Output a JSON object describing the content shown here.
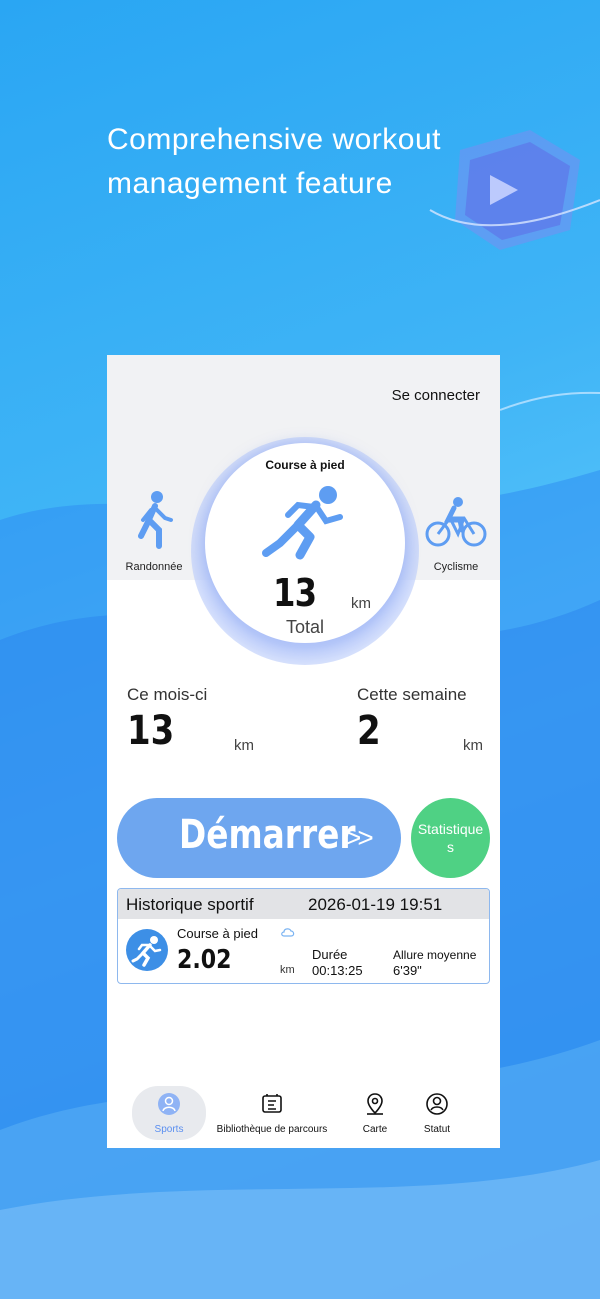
{
  "promo": {
    "headline_line1": "Comprehensive workout",
    "headline_line2": "management feature"
  },
  "app": {
    "login_label": "Se connecter",
    "sports": {
      "left": {
        "label": "Randonnée",
        "icon": "walking-icon"
      },
      "center": {
        "label": "Course à pied",
        "icon": "running-icon"
      },
      "right": {
        "label": "Cyclisme",
        "icon": "cycling-icon"
      }
    },
    "total": {
      "value": "13",
      "unit": "km",
      "label": "Total"
    },
    "month": {
      "label": "Ce mois-ci",
      "value": "13",
      "unit": "km"
    },
    "week": {
      "label": "Cette semaine",
      "value": "2",
      "unit": "km"
    },
    "start_button": {
      "label": "Démarrer",
      "arrows": ">>"
    },
    "stats_button": {
      "label": "Statistiques"
    },
    "history": {
      "title": "Historique sportif",
      "date": "2026-01-19 19:51",
      "record": {
        "type": "Course à pied",
        "distance": "2.02",
        "unit": "km",
        "duration_label": "Durée",
        "duration_value": "00:13:25",
        "pace_label": "Allure moyenne",
        "pace_value": "6'39\""
      }
    },
    "nav": {
      "items": [
        {
          "label": "Sports",
          "icon": "person-icon",
          "active": true
        },
        {
          "label": "Bibliothèque de parcours",
          "icon": "route-library-icon"
        },
        {
          "label": "Carte",
          "icon": "map-pin-icon"
        },
        {
          "label": "Statut",
          "icon": "profile-icon"
        }
      ]
    },
    "colors": {
      "accent": "#6ea6ef",
      "stats_green": "#4fd184",
      "icon_blue": "#3d8fe6",
      "nav_active": "#5b8ff0"
    }
  }
}
